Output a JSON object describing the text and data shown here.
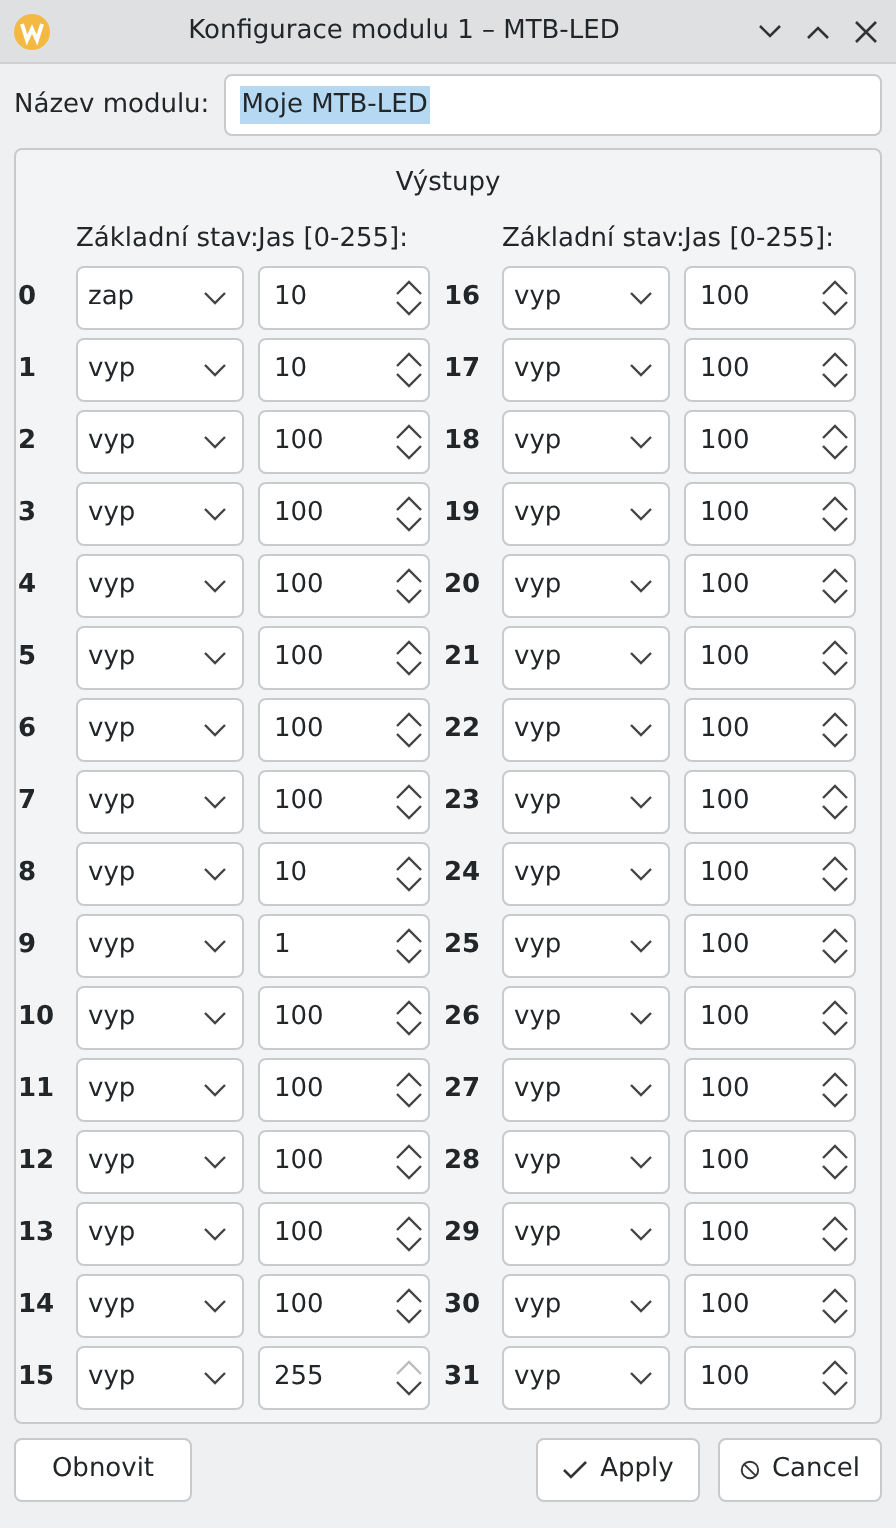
{
  "window": {
    "title": "Konfigurace modulu 1 – MTB-LED"
  },
  "name_field": {
    "label": "Název modulu:",
    "value": "Moje MTB-LED",
    "selected": true
  },
  "outputs_group": {
    "title": "Výstupy",
    "headers": [
      "Základní stav:",
      "Jas [0-255]:",
      "Základní stav:",
      "Jas [0-255]:"
    ],
    "outputs": [
      {
        "number": "0",
        "state": "zap",
        "brightness": "10",
        "up_disabled": false
      },
      {
        "number": "1",
        "state": "vyp",
        "brightness": "10",
        "up_disabled": false
      },
      {
        "number": "2",
        "state": "vyp",
        "brightness": "100",
        "up_disabled": false
      },
      {
        "number": "3",
        "state": "vyp",
        "brightness": "100",
        "up_disabled": false
      },
      {
        "number": "4",
        "state": "vyp",
        "brightness": "100",
        "up_disabled": false
      },
      {
        "number": "5",
        "state": "vyp",
        "brightness": "100",
        "up_disabled": false
      },
      {
        "number": "6",
        "state": "vyp",
        "brightness": "100",
        "up_disabled": false
      },
      {
        "number": "7",
        "state": "vyp",
        "brightness": "100",
        "up_disabled": false
      },
      {
        "number": "8",
        "state": "vyp",
        "brightness": "10",
        "up_disabled": false
      },
      {
        "number": "9",
        "state": "vyp",
        "brightness": "1",
        "up_disabled": false
      },
      {
        "number": "10",
        "state": "vyp",
        "brightness": "100",
        "up_disabled": false
      },
      {
        "number": "11",
        "state": "vyp",
        "brightness": "100",
        "up_disabled": false
      },
      {
        "number": "12",
        "state": "vyp",
        "brightness": "100",
        "up_disabled": false
      },
      {
        "number": "13",
        "state": "vyp",
        "brightness": "100",
        "up_disabled": false
      },
      {
        "number": "14",
        "state": "vyp",
        "brightness": "100",
        "up_disabled": false
      },
      {
        "number": "15",
        "state": "vyp",
        "brightness": "255",
        "up_disabled": true
      },
      {
        "number": "16",
        "state": "vyp",
        "brightness": "100",
        "up_disabled": false
      },
      {
        "number": "17",
        "state": "vyp",
        "brightness": "100",
        "up_disabled": false
      },
      {
        "number": "18",
        "state": "vyp",
        "brightness": "100",
        "up_disabled": false
      },
      {
        "number": "19",
        "state": "vyp",
        "brightness": "100",
        "up_disabled": false
      },
      {
        "number": "20",
        "state": "vyp",
        "brightness": "100",
        "up_disabled": false
      },
      {
        "number": "21",
        "state": "vyp",
        "brightness": "100",
        "up_disabled": false
      },
      {
        "number": "22",
        "state": "vyp",
        "brightness": "100",
        "up_disabled": false
      },
      {
        "number": "23",
        "state": "vyp",
        "brightness": "100",
        "up_disabled": false
      },
      {
        "number": "24",
        "state": "vyp",
        "brightness": "100",
        "up_disabled": false
      },
      {
        "number": "25",
        "state": "vyp",
        "brightness": "100",
        "up_disabled": false
      },
      {
        "number": "26",
        "state": "vyp",
        "brightness": "100",
        "up_disabled": false
      },
      {
        "number": "27",
        "state": "vyp",
        "brightness": "100",
        "up_disabled": false
      },
      {
        "number": "28",
        "state": "vyp",
        "brightness": "100",
        "up_disabled": false
      },
      {
        "number": "29",
        "state": "vyp",
        "brightness": "100",
        "up_disabled": false
      },
      {
        "number": "30",
        "state": "vyp",
        "brightness": "100",
        "up_disabled": false
      },
      {
        "number": "31",
        "state": "vyp",
        "brightness": "100",
        "up_disabled": false
      }
    ]
  },
  "buttons": [
    {
      "kind": "reset",
      "label": "Obnovit"
    },
    {
      "kind": "apply",
      "label": "Apply"
    },
    {
      "kind": "cancel",
      "label": "Cancel"
    }
  ]
}
